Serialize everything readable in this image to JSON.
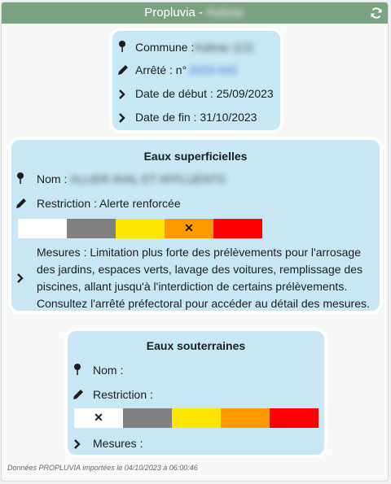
{
  "title": {
    "app": "Propluvia - ",
    "place": "Aubrac"
  },
  "commune_card": {
    "commune_label": "Commune : ",
    "commune_value": "Aubrac (12)",
    "arrete_label": "Arrêté : n° ",
    "arrete_value": "2023-542",
    "debut": "Date de début : 25/09/2023",
    "fin": "Date de fin : 31/10/2023"
  },
  "superficielles": {
    "title": "Eaux superficielles",
    "nom_label": "Nom : ",
    "nom_value": "ALLIER AVAL ET AFFLUENTS",
    "restriction": "Restriction : Alerte renforcée",
    "mark": "✕",
    "mesures_lines": [
      "Mesures : Limitation plus forte des prélèvements pour l'arrosage",
      "des jardins, espaces verts, lavage des voitures, remplissage des",
      "piscines, allant jusqu'à l'interdiction de certains prélèvements.",
      "Consultez l'arrêté préfectoral pour accéder au détail des mesures."
    ]
  },
  "souterraines": {
    "title": "Eaux souterraines",
    "nom": "Nom :",
    "restriction": "Restriction :",
    "mark": "✕",
    "mesures": "Mesures :"
  },
  "levels": [
    {
      "name": "aucune",
      "color": "#ffffff"
    },
    {
      "name": "vigilance",
      "color": "#808080"
    },
    {
      "name": "alerte",
      "color": "#ffe600"
    },
    {
      "name": "alerte-renforcee",
      "color": "#ff9900"
    },
    {
      "name": "crise",
      "color": "#ff0000"
    }
  ],
  "superficielles_level": "alerte-renforcee",
  "souterraines_level": "aucune",
  "footer": "Données PROPLUVIA importées le 04/10/2023 à 06:00:46",
  "icons": [
    "map-pin-icon",
    "pencil-icon",
    "chevron-right-icon",
    "refresh-icon"
  ],
  "colors": {
    "titlebar": "#7aa384",
    "card": "#c7e7f4"
  }
}
